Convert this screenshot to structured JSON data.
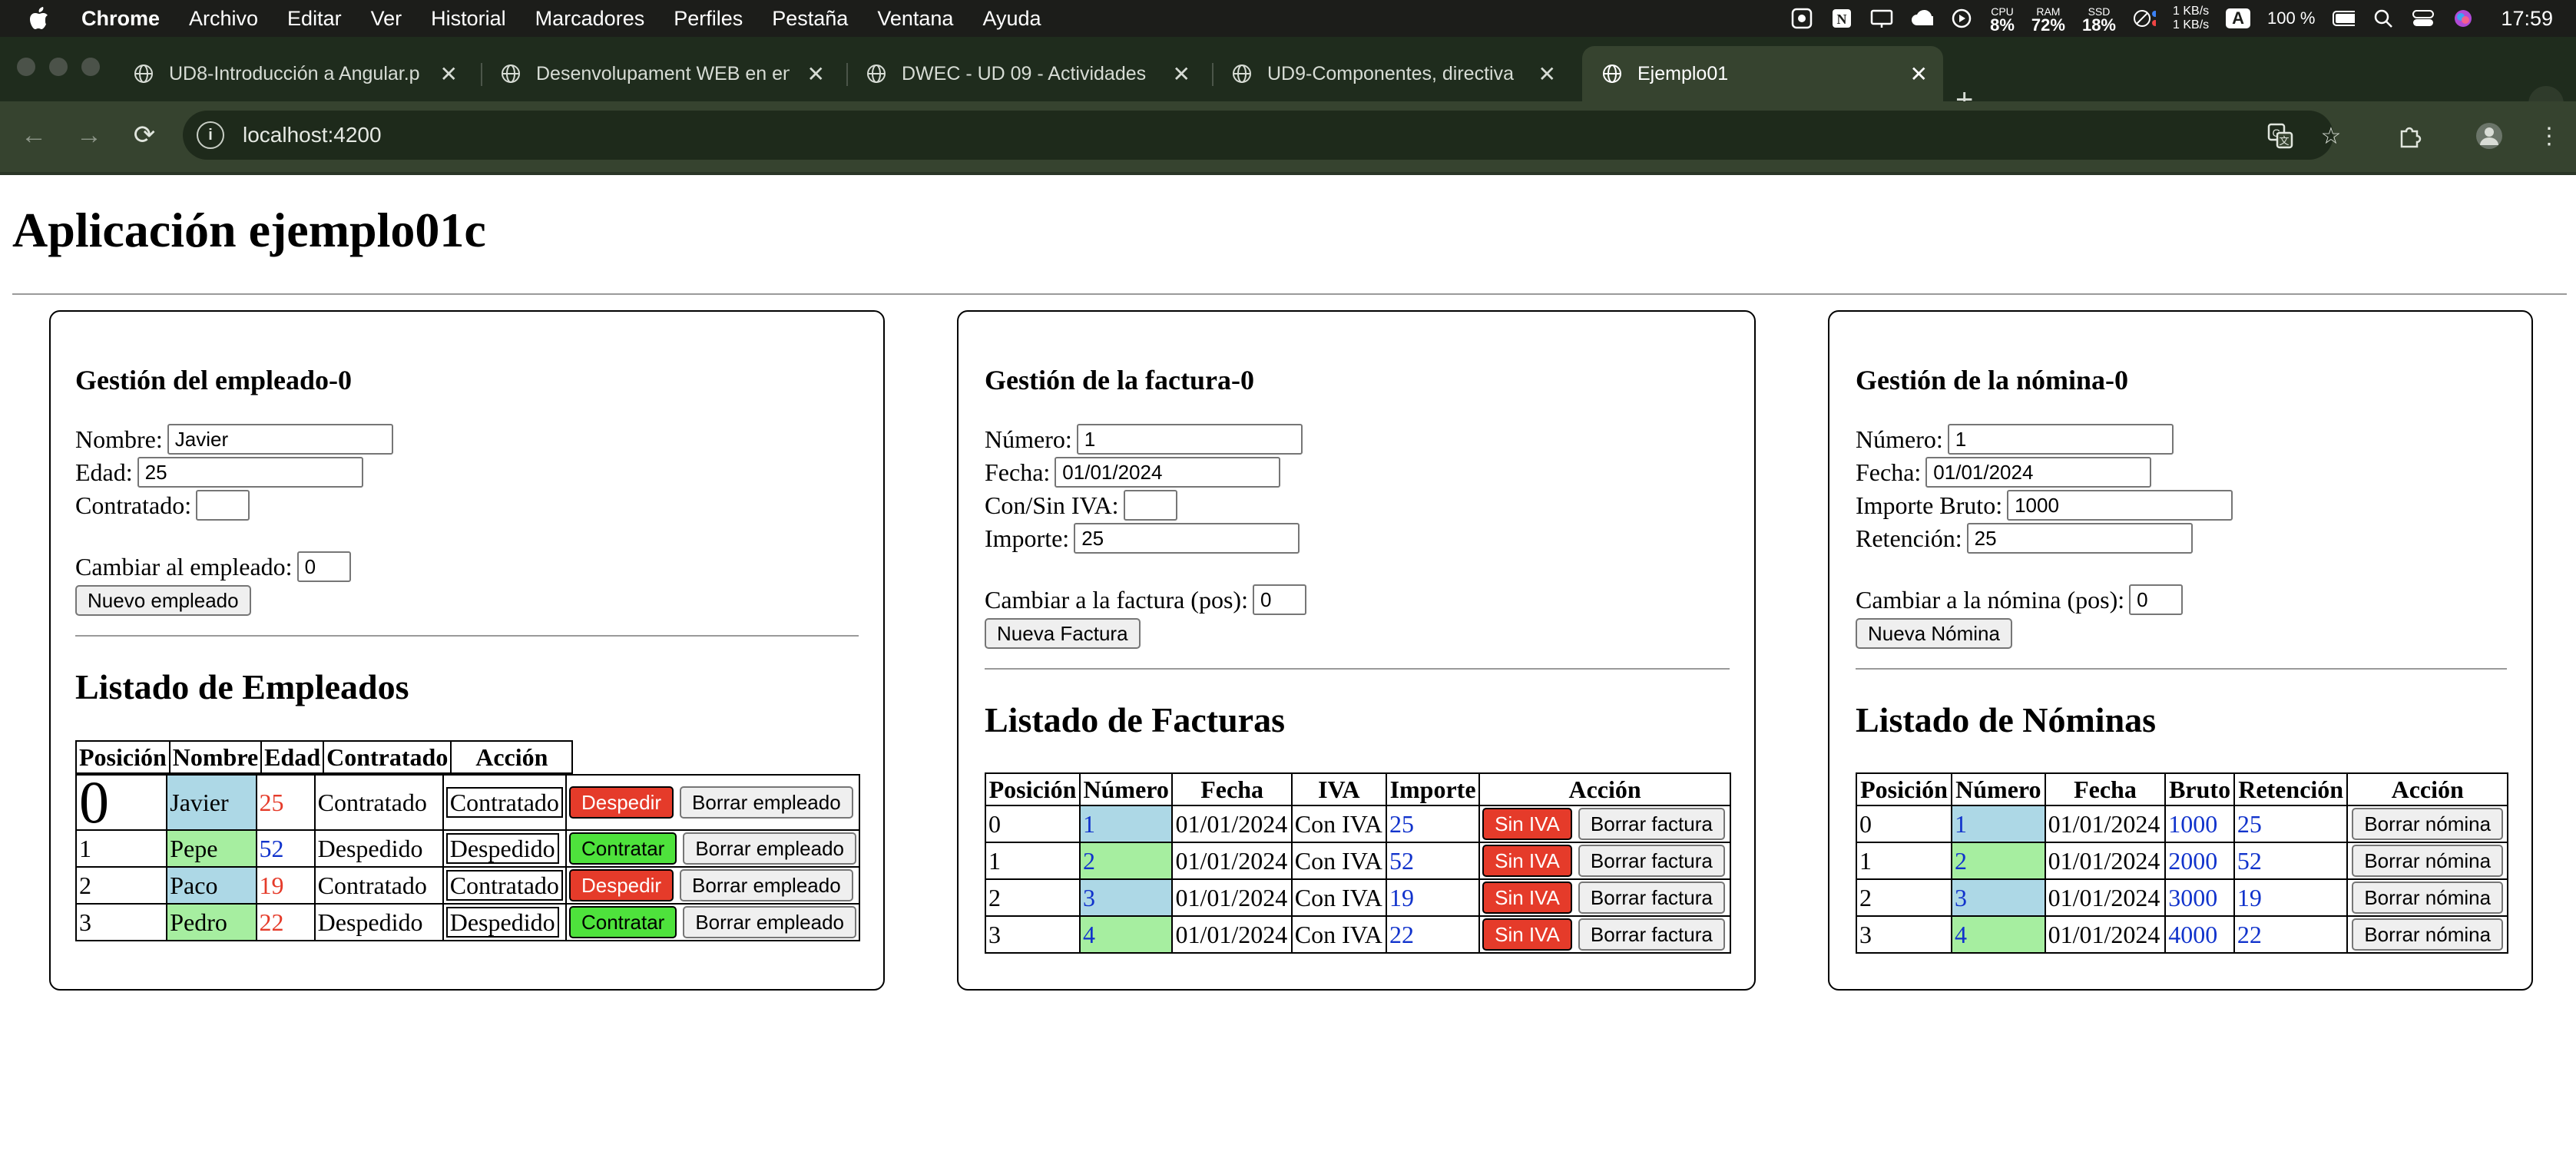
{
  "menubar": {
    "app": "Chrome",
    "items": [
      "Archivo",
      "Editar",
      "Ver",
      "Historial",
      "Marcadores",
      "Perfiles",
      "Pestaña",
      "Ventana",
      "Ayuda"
    ],
    "cpu_label": "CPU",
    "cpu_value": "8%",
    "ram_label": "RAM",
    "ram_value": "72%",
    "ssd_label": "SSD",
    "ssd_value": "18%",
    "net_up": "1 KB/s",
    "net_down": "1 KB/s",
    "input_badge": "A",
    "battery": "100 %",
    "time": "17:59"
  },
  "tabs": [
    {
      "title": "UD8-Introducción a Angular.p",
      "icon": "globe-icon",
      "active": false
    },
    {
      "title": "Desenvolupament WEB en en",
      "icon": "globe-icon",
      "active": false
    },
    {
      "title": "DWEC - UD 09 - Actividades",
      "icon": "globe-icon",
      "active": false
    },
    {
      "title": "UD9-Componentes, directiva",
      "icon": "globe-icon",
      "active": false
    },
    {
      "title": "Ejemplo01",
      "icon": "globe-icon",
      "active": true
    }
  ],
  "toolbar": {
    "url": "localhost:4200"
  },
  "page": {
    "title": "Aplicación ejemplo01c",
    "empleado": {
      "heading": "Gestión del empleado-0",
      "nombre_label": "Nombre:",
      "nombre_value": "Javier",
      "edad_label": "Edad:",
      "edad_value": "25",
      "contratado_label": "Contratado:",
      "contratado_value": "",
      "cambiar_label": "Cambiar al empleado:",
      "cambiar_value": "0",
      "nuevo_button": "Nuevo empleado",
      "list_title": "Listado de Empleados",
      "columns": [
        "Posición",
        "Nombre",
        "Edad",
        "Contratado",
        "Acción"
      ],
      "rows": [
        {
          "pos": "0",
          "nombre": "Javier",
          "edad": "25",
          "contratado": "Contratado",
          "estado_btn": "Contratado",
          "accion": "Despedir",
          "borrar": "Borrar empleado"
        },
        {
          "pos": "1",
          "nombre": "Pepe",
          "edad": "52",
          "contratado": "Despedido",
          "estado_btn": "Despedido",
          "accion": "Contratar",
          "borrar": "Borrar empleado"
        },
        {
          "pos": "2",
          "nombre": "Paco",
          "edad": "19",
          "contratado": "Contratado",
          "estado_btn": "Contratado",
          "accion": "Despedir",
          "borrar": "Borrar empleado"
        },
        {
          "pos": "3",
          "nombre": "Pedro",
          "edad": "22",
          "contratado": "Despedido",
          "estado_btn": "Despedido",
          "accion": "Contratar",
          "borrar": "Borrar empleado"
        }
      ]
    },
    "factura": {
      "heading": "Gestión de la factura-0",
      "numero_label": "Número:",
      "numero_value": "1",
      "fecha_label": "Fecha:",
      "fecha_value": "01/01/2024",
      "iva_label": "Con/Sin IVA:",
      "iva_value": "",
      "importe_label": "Importe:",
      "importe_value": "25",
      "cambiar_label": "Cambiar a la factura (pos):",
      "cambiar_value": "0",
      "nuevo_button": "Nueva Factura",
      "list_title": "Listado de Facturas",
      "columns": [
        "Posición",
        "Número",
        "Fecha",
        "IVA",
        "Importe",
        "Acción"
      ],
      "rows": [
        {
          "pos": "0",
          "numero": "1",
          "fecha": "01/01/2024",
          "iva": "Con IVA",
          "importe": "25",
          "accion": "Sin IVA",
          "borrar": "Borrar factura"
        },
        {
          "pos": "1",
          "numero": "2",
          "fecha": "01/01/2024",
          "iva": "Con IVA",
          "importe": "52",
          "accion": "Sin IVA",
          "borrar": "Borrar factura"
        },
        {
          "pos": "2",
          "numero": "3",
          "fecha": "01/01/2024",
          "iva": "Con IVA",
          "importe": "19",
          "accion": "Sin IVA",
          "borrar": "Borrar factura"
        },
        {
          "pos": "3",
          "numero": "4",
          "fecha": "01/01/2024",
          "iva": "Con IVA",
          "importe": "22",
          "accion": "Sin IVA",
          "borrar": "Borrar factura"
        }
      ]
    },
    "nomina": {
      "heading": "Gestión de la nómina-0",
      "numero_label": "Número:",
      "numero_value": "1",
      "fecha_label": "Fecha:",
      "fecha_value": "01/01/2024",
      "bruto_label": "Importe Bruto:",
      "bruto_value": "1000",
      "retencion_label": "Retención:",
      "retencion_value": "25",
      "cambiar_label": "Cambiar a la nómina (pos):",
      "cambiar_value": "0",
      "nuevo_button": "Nueva Nómina",
      "list_title": "Listado de Nóminas",
      "columns": [
        "Posición",
        "Número",
        "Fecha",
        "Bruto",
        "Retención",
        "Acción"
      ],
      "rows": [
        {
          "pos": "0",
          "numero": "1",
          "fecha": "01/01/2024",
          "bruto": "1000",
          "retencion": "25",
          "borrar": "Borrar nómina"
        },
        {
          "pos": "1",
          "numero": "2",
          "fecha": "01/01/2024",
          "bruto": "2000",
          "retencion": "52",
          "borrar": "Borrar nómina"
        },
        {
          "pos": "2",
          "numero": "3",
          "fecha": "01/01/2024",
          "bruto": "3000",
          "retencion": "19",
          "borrar": "Borrar nómina"
        },
        {
          "pos": "3",
          "numero": "4",
          "fecha": "01/01/2024",
          "bruto": "4000",
          "retencion": "22",
          "borrar": "Borrar nómina"
        }
      ]
    }
  }
}
